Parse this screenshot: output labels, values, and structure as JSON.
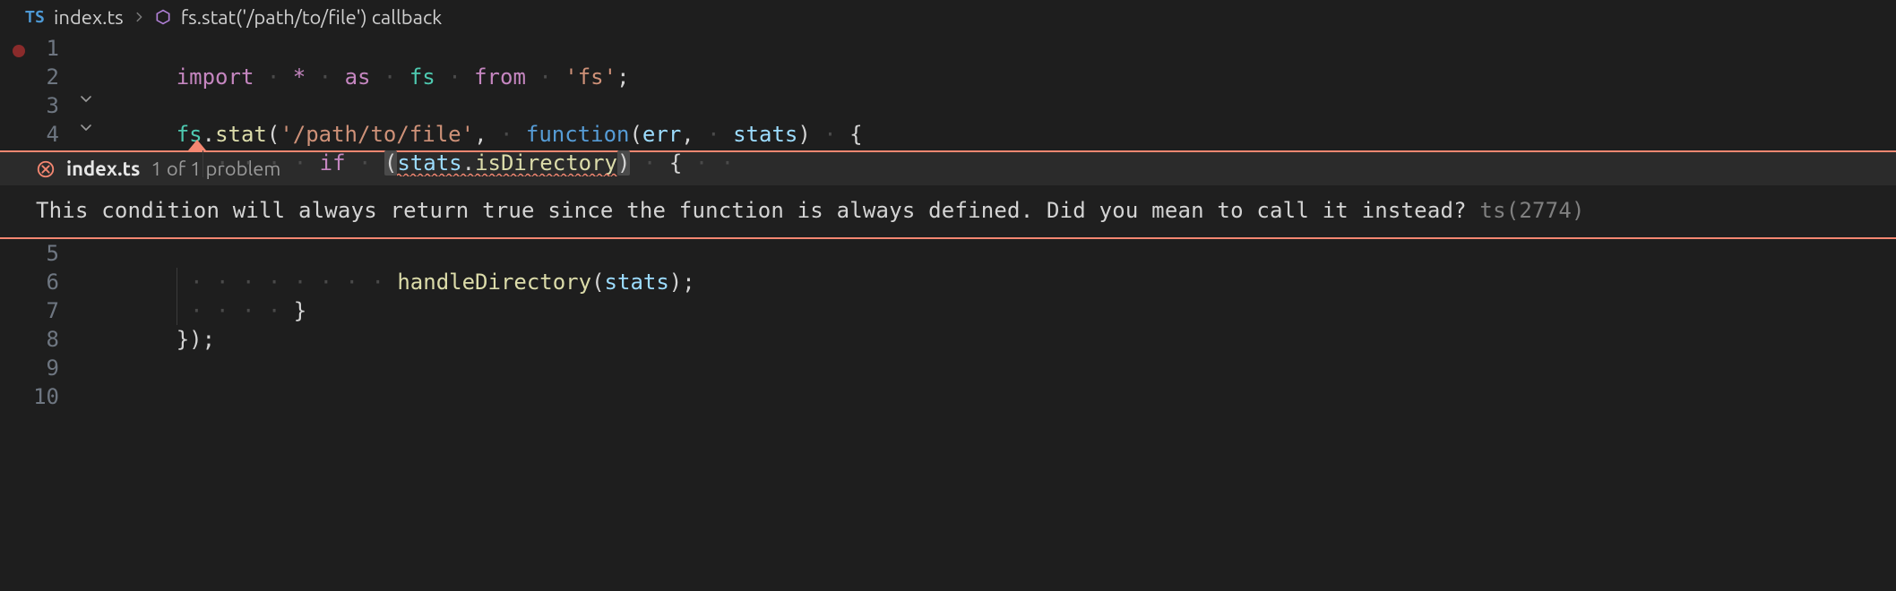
{
  "breadcrumb": {
    "ts_badge": "TS",
    "file": "index.ts",
    "symbol": "fs.stat('/path/to/file') callback"
  },
  "gutter": {
    "l1": "1",
    "l2": "2",
    "l3": "3",
    "l4": "4",
    "l5": "5",
    "l6": "6",
    "l7": "7",
    "l8": "8",
    "l9": "9",
    "l10": "10"
  },
  "code": {
    "line1": {
      "kw_import": "import",
      "star": "*",
      "kw_as": "as",
      "ns": "fs",
      "kw_from": "from",
      "str": "'fs'",
      "semi": ";"
    },
    "line3": {
      "ns": "fs",
      "dot": ".",
      "method": "stat",
      "open": "(",
      "str": "'/path/to/file'",
      "comma": ",",
      "kw_function": "function",
      "open2": "(",
      "p1": "err",
      "comma2": ",",
      "p2": "stats",
      "close2": ")",
      "brace": "{"
    },
    "line4": {
      "kw_if": "if",
      "open": "(",
      "obj": "stats",
      "dot": ".",
      "prop": "isDirectory",
      "close": ")",
      "brace": "{"
    },
    "line5": {
      "fn": "handleDirectory",
      "open": "(",
      "arg": "stats",
      "close": ")",
      "semi": ";"
    },
    "line6": {
      "brace": "}"
    },
    "line7": {
      "brace_paren_semi": "});"
    }
  },
  "problem": {
    "file": "index.ts",
    "count_label": "1 of 1 problem",
    "message": "This condition will always return true since the function is always defined. Did you mean to call it instead?",
    "code_label": "ts(2774)"
  }
}
